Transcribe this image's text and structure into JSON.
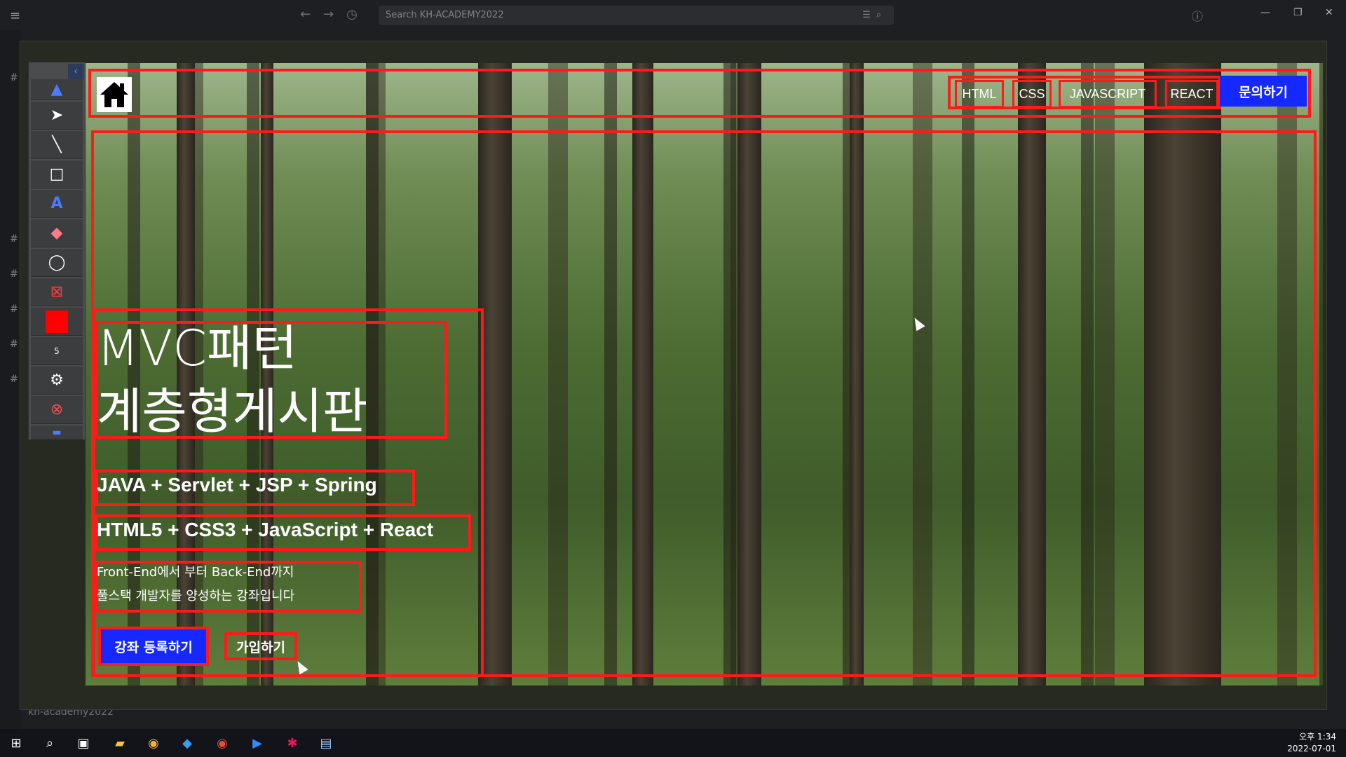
{
  "app": {
    "search_placeholder": "Search KH-ACADEMY2022",
    "workspace_name": "kh-academy2022"
  },
  "toolbar": {
    "stroke_size": "5",
    "pen_color": "#ff0000"
  },
  "site": {
    "nav": [
      "HTML",
      "CSS",
      "JAVASCRIPT",
      "REACT"
    ],
    "inquiry_label": "문의하기",
    "hero_line1": "MVC패턴",
    "hero_line2": "계층형게시판",
    "stack_backend": "JAVA + Servlet + JSP + Spring",
    "stack_frontend": "HTML5 + CSS3 + JavaScript + React",
    "desc_line1": "Front-End에서 부터 Back-End까지",
    "desc_line2": "풀스택 개발자를 양성하는 강좌입니다",
    "register_label": "강좌 등록하기",
    "join_label": "가입하기",
    "accent_color": "#1428ff",
    "annotation_color": "#ff1a1a"
  },
  "taskbar": {
    "time": "오후 1:34",
    "date": "2022-07-01",
    "icons": [
      "windows-start-icon",
      "search-icon",
      "task-view-icon",
      "file-explorer-icon",
      "chrome-icon",
      "vscode-icon",
      "chrome-profile-icon",
      "zoom-icon",
      "slack-icon",
      "notepad-icon"
    ]
  }
}
